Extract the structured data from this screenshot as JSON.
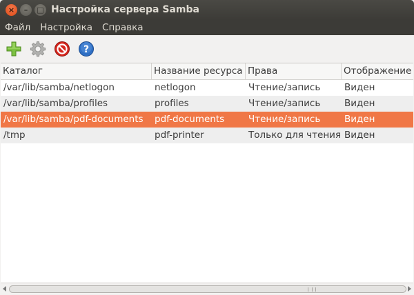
{
  "window": {
    "title": "Настройка сервера Samba",
    "controls": {
      "close_glyph": "×",
      "minimize_glyph": "–",
      "maximize_glyph": "□"
    }
  },
  "menubar": {
    "items": [
      {
        "label": "Файл"
      },
      {
        "label": "Настройка"
      },
      {
        "label": "Справка"
      }
    ]
  },
  "toolbar": {
    "buttons": [
      {
        "icon": "add-icon",
        "color": "#7cc142"
      },
      {
        "icon": "gear-icon",
        "color": "#9a9a9a"
      },
      {
        "icon": "delete-icon",
        "color": "#d6271e"
      },
      {
        "icon": "help-icon",
        "color": "#2f6fc4"
      }
    ]
  },
  "table": {
    "columns": [
      "Каталог",
      "Название ресурса",
      "Права",
      "Отображение"
    ],
    "rows": [
      {
        "cells": [
          "/var/lib/samba/netlogon",
          "netlogon",
          "Чтение/запись",
          "Виден"
        ]
      },
      {
        "cells": [
          "/var/lib/samba/profiles",
          "profiles",
          "Чтение/запись",
          "Виден"
        ]
      },
      {
        "cells": [
          "/var/lib/samba/pdf-documents",
          "pdf-documents",
          "Чтение/запись",
          "Виден"
        ]
      },
      {
        "cells": [
          "/tmp",
          "pdf-printer",
          "Только для чтения",
          "Виден"
        ]
      }
    ],
    "selected_row": 2,
    "selection_color": "#f07746"
  }
}
